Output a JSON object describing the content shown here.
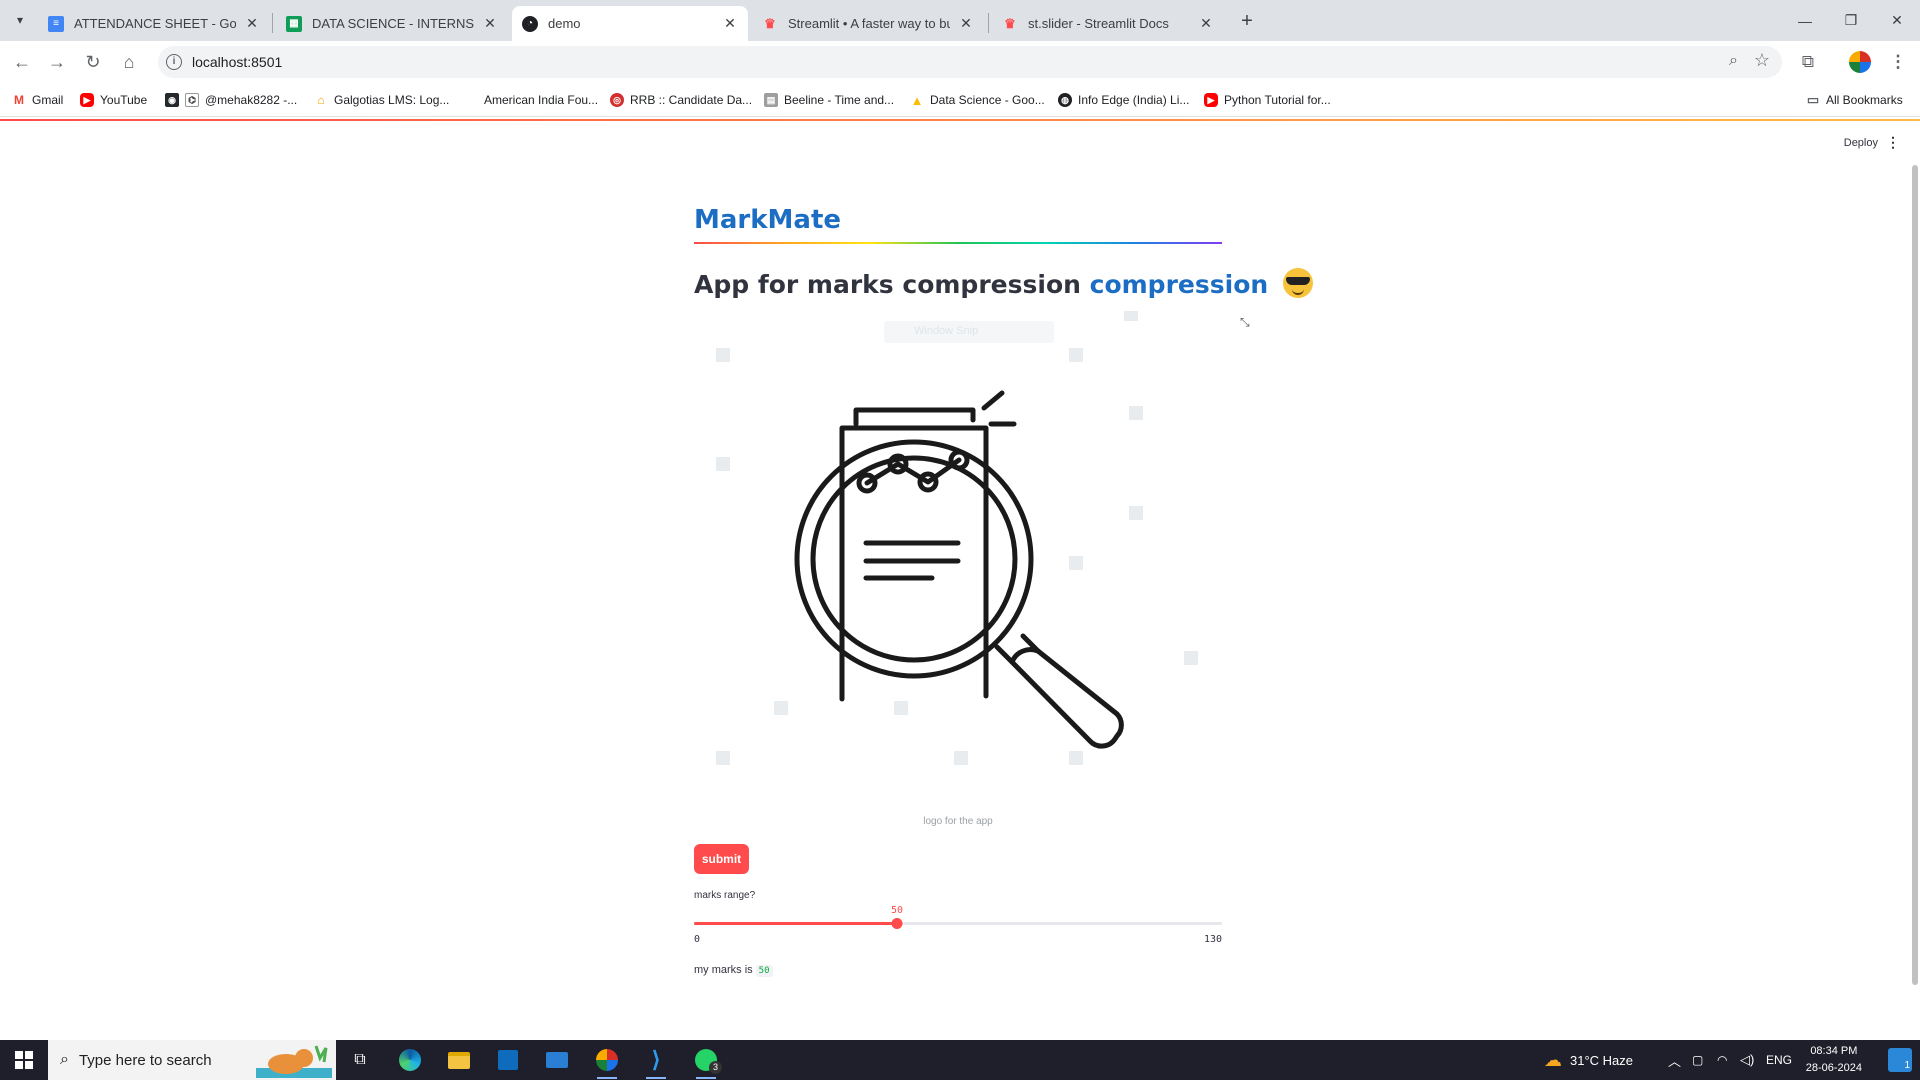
{
  "browser": {
    "tabs": [
      {
        "title": "ATTENDANCE SHEET - Google Docs",
        "icon": "google-docs-icon",
        "color": "#4285f4"
      },
      {
        "title": "DATA SCIENCE - INTERNS ATTENDANCE",
        "icon": "google-sheets-icon",
        "color": "#0f9d58"
      },
      {
        "title": "demo",
        "icon": "streamlit-icon",
        "color": "#202124"
      },
      {
        "title": "Streamlit • A faster way to build",
        "icon": "streamlit-crown-icon",
        "color": "#ff4b4b"
      },
      {
        "title": "st.slider - Streamlit Docs",
        "icon": "streamlit-crown-icon",
        "color": "#ff4b4b"
      }
    ],
    "url": "localhost:8501",
    "bookmarks": [
      {
        "label": "Gmail",
        "icon": "gmail-icon",
        "color": "#ea4335"
      },
      {
        "label": "YouTube",
        "icon": "youtube-icon",
        "color": "#ff0000"
      },
      {
        "label": "@mehak8282 -...",
        "icon": "github-icon",
        "color": "#24292e"
      },
      {
        "label": "Galgotias LMS: Log...",
        "icon": "lms-icon",
        "color": "#f4a300"
      },
      {
        "label": "American India Fou...",
        "icon": "blank-icon",
        "color": "#ffffff"
      },
      {
        "label": "RRB :: Candidate Da...",
        "icon": "rrb-icon",
        "color": "#d32f2f"
      },
      {
        "label": "Beeline - Time and...",
        "icon": "file-icon",
        "color": "#9e9e9e"
      },
      {
        "label": "Data Science - Goo...",
        "icon": "google-drive-icon",
        "color": "#fbbc04"
      },
      {
        "label": "Info Edge (India) Li...",
        "icon": "globe-icon",
        "color": "#202124"
      },
      {
        "label": "Python Tutorial for...",
        "icon": "youtube-icon",
        "color": "#ff0000"
      }
    ],
    "all_bookmarks": "All Bookmarks"
  },
  "app": {
    "deploy": "Deploy",
    "title": "MarkMate",
    "subtitle_prefix": "App for marks compression",
    "subtitle_highlight": "compression",
    "snip_text": "Window Snip",
    "image_caption": "logo for the app",
    "submit_label": "submit",
    "slider": {
      "label": "marks range?",
      "min": 0,
      "max": 130,
      "value": 50,
      "min_label": "0",
      "max_label": "130",
      "value_label": "50",
      "accent": "#ff4b4b"
    },
    "marks_text": "my marks is",
    "marks_value": "50"
  },
  "taskbar": {
    "search_placeholder": "Type here to search",
    "weather": "31°C  Haze",
    "language": "ENG",
    "time": "08:34 PM",
    "date": "28-06-2024",
    "notifications": "1",
    "whatsapp_badge": "3"
  }
}
